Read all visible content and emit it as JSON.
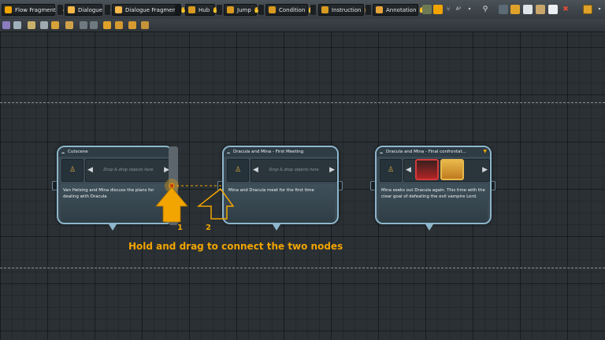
{
  "toolbar": {
    "buttons": [
      {
        "label": "Flow Fragment"
      },
      {
        "label": "Dialogue"
      },
      {
        "label": "Dialogue Fragment"
      },
      {
        "label": "Hub"
      },
      {
        "label": "Jump"
      },
      {
        "label": "Condition"
      },
      {
        "label": "Instruction"
      },
      {
        "label": "Annotation"
      }
    ]
  },
  "nodes": [
    {
      "title": "Cutscene",
      "drop_hint": "Drop & drop objects here",
      "text": "Van Helsing and Mina discuss the plans for dealing with Dracula"
    },
    {
      "title": "Dracula and Mina - First Meeting",
      "drop_hint": "Drop & drop objects here",
      "text": "Mina and Dracula meet for the first time"
    },
    {
      "title": "Dracula and Mina - Final confrontat...",
      "text": "Mina seeks out Dracula again. This time with the clear goal of defeating the evil vampire Lord."
    }
  ],
  "overlay": {
    "caption": "Hold and drag to connect the two nodes",
    "step1": "1",
    "step2": "2"
  },
  "colors": {
    "accent": "#f2a400",
    "node_border": "#8db6cc",
    "canvas": "#2a3034"
  }
}
